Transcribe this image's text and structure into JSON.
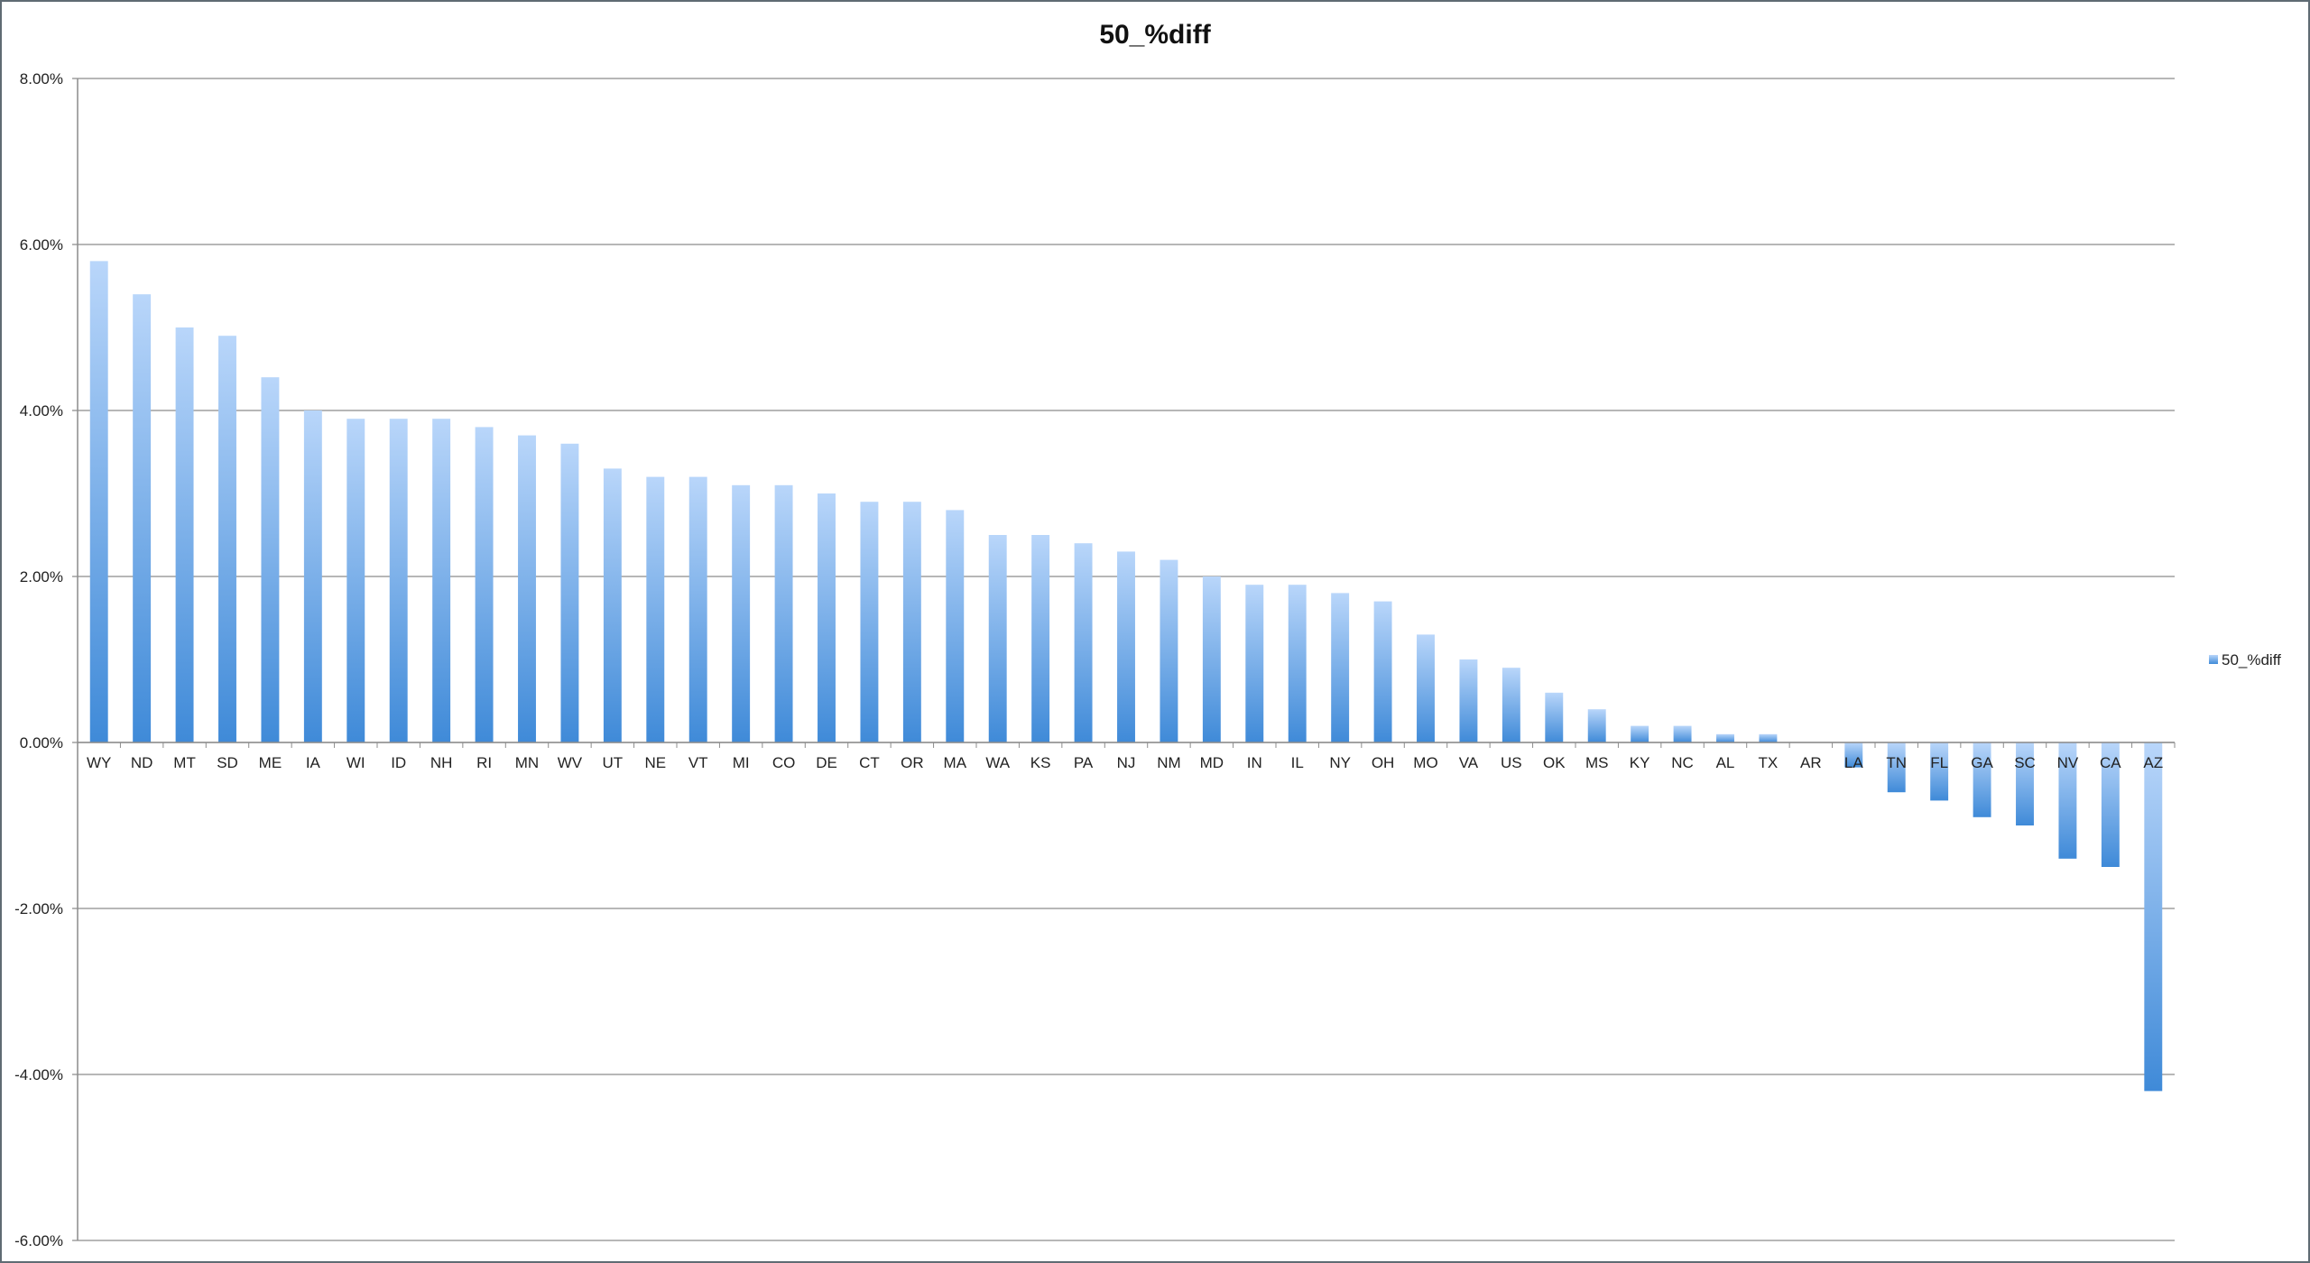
{
  "chart_data": {
    "type": "bar",
    "title": "50_%diff",
    "categories": [
      "WY",
      "ND",
      "MT",
      "SD",
      "ME",
      "IA",
      "WI",
      "ID",
      "NH",
      "RI",
      "MN",
      "WV",
      "UT",
      "NE",
      "VT",
      "MI",
      "CO",
      "DE",
      "CT",
      "OR",
      "MA",
      "WA",
      "KS",
      "PA",
      "NJ",
      "NM",
      "MD",
      "IN",
      "IL",
      "NY",
      "OH",
      "MO",
      "VA",
      "US",
      "OK",
      "MS",
      "KY",
      "NC",
      "AL",
      "TX",
      "AR",
      "LA",
      "TN",
      "FL",
      "GA",
      "SC",
      "NV",
      "CA",
      "AZ"
    ],
    "series": [
      {
        "name": "50_%diff",
        "values": [
          5.8,
          5.4,
          5.0,
          4.9,
          4.4,
          4.0,
          3.9,
          3.9,
          3.9,
          3.8,
          3.7,
          3.6,
          3.3,
          3.2,
          3.2,
          3.1,
          3.1,
          3.0,
          2.9,
          2.9,
          2.8,
          2.5,
          2.5,
          2.4,
          2.3,
          2.2,
          2.0,
          1.9,
          1.9,
          1.8,
          1.7,
          1.3,
          1.0,
          0.9,
          0.6,
          0.4,
          0.2,
          0.2,
          0.1,
          0.1,
          0.0,
          -0.3,
          -0.6,
          -0.7,
          -0.9,
          -1.0,
          -1.4,
          -1.5,
          -4.2
        ]
      }
    ],
    "ylim": [
      -6,
      8
    ],
    "yticks": [
      "-6.00%",
      "-4.00%",
      "-2.00%",
      "0.00%",
      "2.00%",
      "4.00%",
      "6.00%",
      "8.00%"
    ],
    "ytick_values": [
      -6,
      -4,
      -2,
      0,
      2,
      4,
      6,
      8
    ],
    "xlabel": "",
    "ylabel": "",
    "grid": true,
    "legend_position": "right",
    "colors": {
      "bar_top": "#b9d6fa",
      "bar_bottom": "#3f8ad8",
      "grid": "#8c8c8c",
      "axis": "#8c8c8c"
    }
  }
}
